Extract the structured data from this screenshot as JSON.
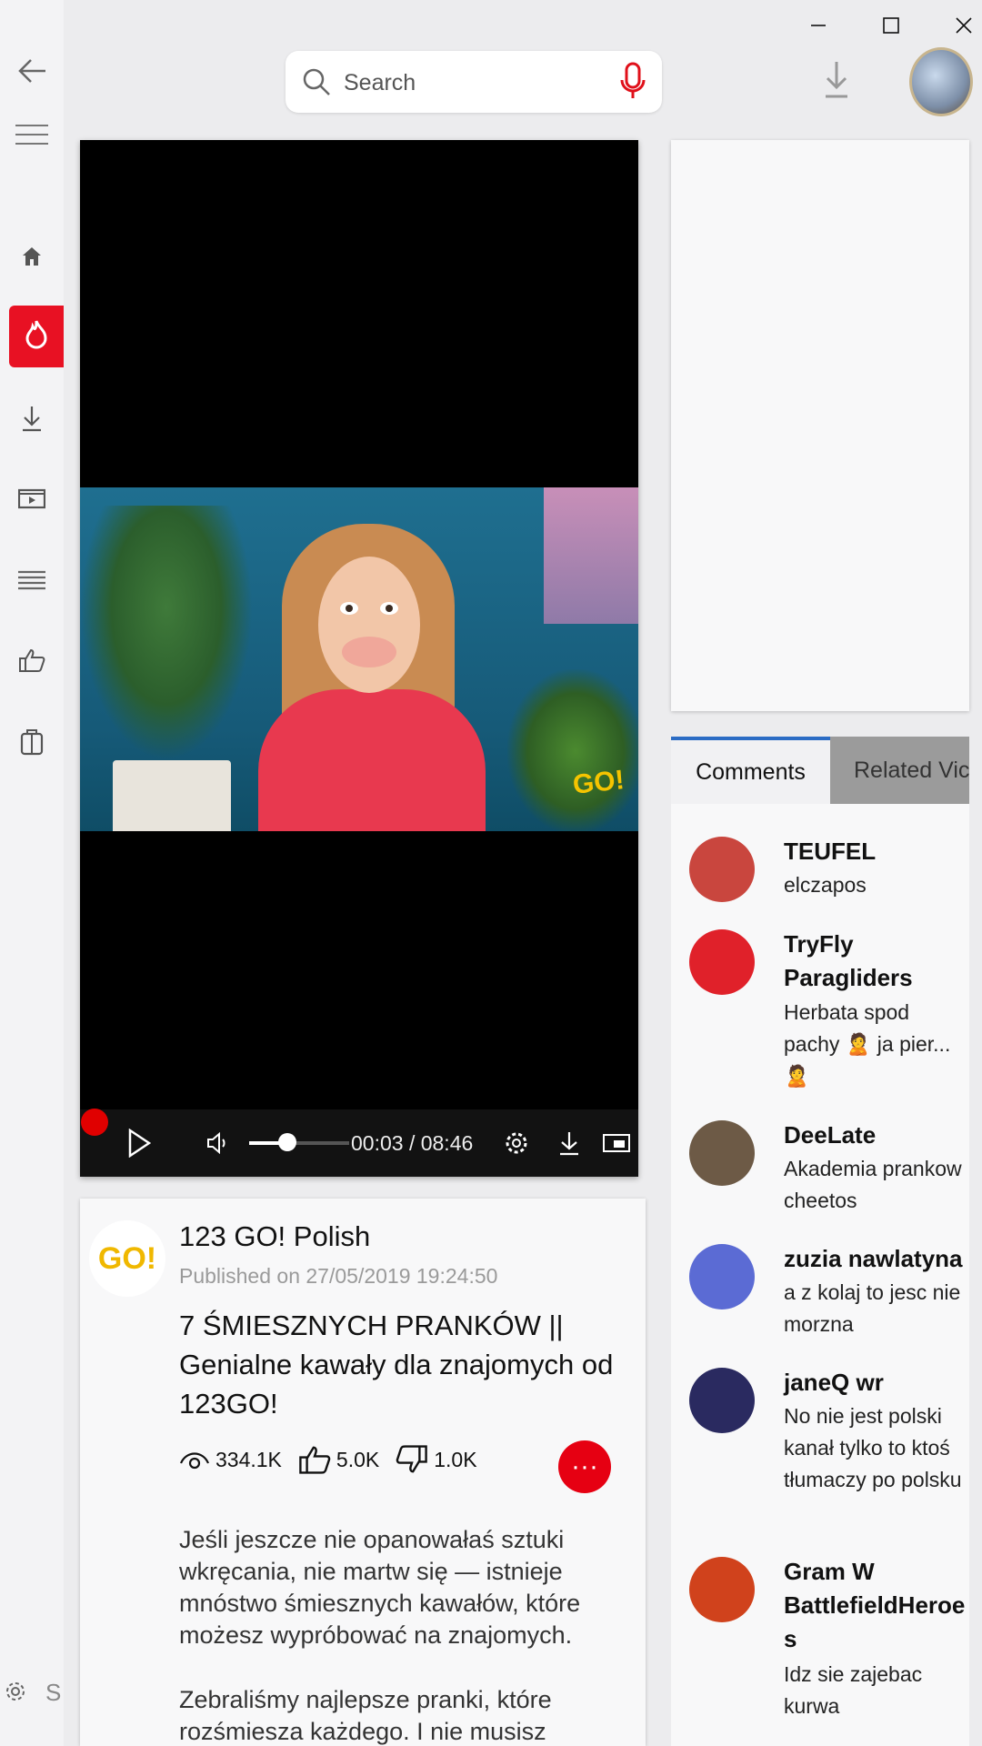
{
  "window": {
    "minimize_icon": "minimize-icon",
    "maximize_icon": "maximize-icon",
    "close_icon": "close-icon"
  },
  "search": {
    "placeholder": "Search"
  },
  "rail": {
    "settings_label": "S"
  },
  "player": {
    "time": "00:03 / 08:46",
    "volume_level": 0.38,
    "progress_fraction": 0.006,
    "overlay_logo": "GO!"
  },
  "video": {
    "channel_logo_text": "GO!",
    "channel": "123 GO! Polish",
    "published": "Published on  27/05/2019 19:24:50",
    "title": "7 ŚMIESZNYCH PRANKÓW || Genialne kawały dla znajomych od 123GO!",
    "views": "334.1K",
    "likes": "5.0K",
    "dislikes": "1.0K",
    "more": "···",
    "description_1": "Jeśli jeszcze nie opanowałaś sztuki wkręcania, nie martw się — istnieje mnóstwo śmiesznych kawałów, które możesz wypróbować na znajomych.",
    "description_2": "Zebraliśmy najlepsze pranki, które rozśmiesza każdego. I nie musisz"
  },
  "tabs": {
    "comments": "Comments",
    "related": "Related Vic"
  },
  "comments": [
    {
      "name": "TEUFEL",
      "text": "elczapos",
      "color": "#c9463e"
    },
    {
      "name": "TryFly Paragliders",
      "text": "Herbata spod pachy 🙎 ja pier... 🙎",
      "color": "#e0212a"
    },
    {
      "name": "DeeLate",
      "text": "Akademia prankow cheetos",
      "color": "#6d5a46"
    },
    {
      "name": "zuzia nawlatyna",
      "text": "a z kolaj to jesc nie morzna",
      "color": "#5b6bd4"
    },
    {
      "name": "janeQ wr",
      "text": "No nie jest polski kanał tylko to ktoś tłumaczy po polsku",
      "color": "#2a2a60"
    },
    {
      "name": "Gram W BattlefieldHeroe s",
      "text": "Idz sie zajebac kurwa",
      "color": "#d0421c"
    }
  ]
}
